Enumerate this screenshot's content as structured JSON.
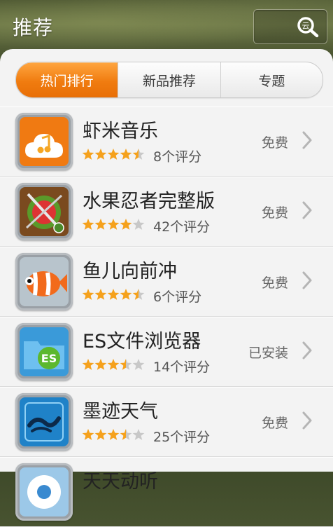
{
  "header": {
    "title": "推荐",
    "search_icon": "search-icon"
  },
  "tabs": [
    {
      "label": "热门排行",
      "active": true
    },
    {
      "label": "新品推荐",
      "active": false
    },
    {
      "label": "专题",
      "active": false
    }
  ],
  "colors": {
    "accent": "#f07c10",
    "star_filled": "#f5a11c",
    "star_empty": "#c8c8c8"
  },
  "apps": [
    {
      "name": "虾米音乐",
      "rating": 4.5,
      "rating_count_text": "8个评分",
      "price": "免费",
      "icon": "music-cloud-icon"
    },
    {
      "name": "水果忍者完整版",
      "rating": 4.0,
      "rating_count_text": "42个评分",
      "price": "免费",
      "icon": "fruit-ninja-icon"
    },
    {
      "name": "鱼儿向前冲",
      "rating": 4.5,
      "rating_count_text": "6个评分",
      "price": "免费",
      "icon": "clownfish-icon"
    },
    {
      "name": "ES文件浏览器",
      "rating": 3.5,
      "rating_count_text": "14个评分",
      "price": "已安装",
      "icon": "es-folder-icon"
    },
    {
      "name": "墨迹天气",
      "rating": 3.5,
      "rating_count_text": "25个评分",
      "price": "免费",
      "icon": "weather-icon"
    },
    {
      "name": "天天动听",
      "rating": null,
      "rating_count_text": "",
      "price": "",
      "icon": "music-player-icon"
    }
  ]
}
